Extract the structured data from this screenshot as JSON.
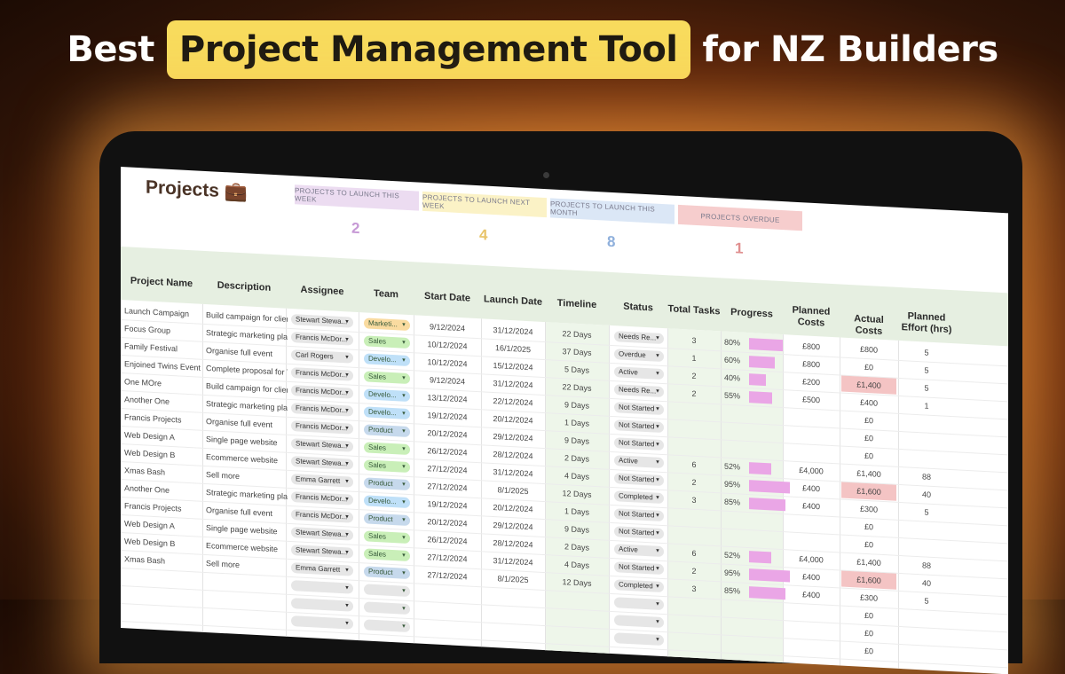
{
  "headline": {
    "before": "Best",
    "highlight": "Project Management Tool",
    "after": "for NZ Builders"
  },
  "sheet": {
    "title": "Projects 💼",
    "kpis": [
      {
        "label": "PROJECTS TO LAUNCH THIS WEEK",
        "value": "2",
        "tab_color": "#ecdcf1",
        "num_color": "#c79ad6"
      },
      {
        "label": "PROJECTS TO LAUNCH NEXT WEEK",
        "value": "4",
        "tab_color": "#fbf2c6",
        "num_color": "#e8c46a"
      },
      {
        "label": "PROJECTS TO LAUNCH THIS MONTH",
        "value": "8",
        "tab_color": "#dbe7f6",
        "num_color": "#8fb0dc"
      },
      {
        "label": "PROJECTS OVERDUE",
        "value": "1",
        "tab_color": "#f6cdcd",
        "num_color": "#e08f8f"
      }
    ],
    "columns": [
      "Project Name",
      "Description",
      "Assignee",
      "Team",
      "Start Date",
      "Launch Date",
      "Timeline",
      "Status",
      "Total Tasks",
      "Progress",
      "Planned Costs",
      "Actual Costs",
      "Planned Effort (hrs)"
    ],
    "team_colors": {
      "Marketi...": "#f9dba0",
      "Sales": "#c9efb8",
      "Develo...": "#bfe0f8",
      "Product": "#c6d9ec"
    },
    "rows": [
      {
        "name": "Launch Campaign",
        "desc": "Build campaign for client",
        "assignee": "Stewart Stewa...",
        "team": "Marketi...",
        "start": "9/12/2024",
        "launch": "31/12/2024",
        "timeline": "22 Days",
        "status": "Needs Re...",
        "tasks": "3",
        "progress": 0.8,
        "progress_label": "80%",
        "planned": "£800",
        "actual": "£800",
        "actual_over": false,
        "effort": "5"
      },
      {
        "name": "Focus Group",
        "desc": "Strategic marketing plan",
        "assignee": "Francis McDor...",
        "team": "Sales",
        "start": "10/12/2024",
        "launch": "16/1/2025",
        "timeline": "37 Days",
        "status": "Overdue",
        "tasks": "1",
        "progress": 0.6,
        "progress_label": "60%",
        "planned": "£800",
        "actual": "£0",
        "actual_over": false,
        "effort": "5"
      },
      {
        "name": "Family Festival",
        "desc": "Organise full event",
        "assignee": "Carl Rogers",
        "team": "Develo...",
        "start": "10/12/2024",
        "launch": "15/12/2024",
        "timeline": "5 Days",
        "status": "Active",
        "tasks": "2",
        "progress": 0.4,
        "progress_label": "40%",
        "planned": "£200",
        "actual": "£1,400",
        "actual_over": true,
        "effort": "5"
      },
      {
        "name": "Enjoined Twins Event",
        "desc": "Complete proposal for Tw",
        "assignee": "Francis McDor...",
        "team": "Sales",
        "start": "9/12/2024",
        "launch": "31/12/2024",
        "timeline": "22 Days",
        "status": "Needs Re...",
        "tasks": "2",
        "progress": 0.55,
        "progress_label": "55%",
        "planned": "£500",
        "actual": "£400",
        "actual_over": false,
        "effort": "1"
      },
      {
        "name": "One MOre",
        "desc": "Build campaign for client",
        "assignee": "Francis McDor...",
        "team": "Develo...",
        "start": "13/12/2024",
        "launch": "22/12/2024",
        "timeline": "9 Days",
        "status": "Not Started",
        "tasks": "",
        "progress": null,
        "progress_label": "",
        "planned": "",
        "actual": "£0",
        "actual_over": false,
        "effort": ""
      },
      {
        "name": "Another One",
        "desc": "Strategic marketing plan",
        "assignee": "Francis McDor...",
        "team": "Develo...",
        "start": "19/12/2024",
        "launch": "20/12/2024",
        "timeline": "1 Days",
        "status": "Not Started",
        "tasks": "",
        "progress": null,
        "progress_label": "",
        "planned": "",
        "actual": "£0",
        "actual_over": false,
        "effort": ""
      },
      {
        "name": "Francis Projects",
        "desc": "Organise full event",
        "assignee": "Francis McDor...",
        "team": "Product",
        "start": "20/12/2024",
        "launch": "29/12/2024",
        "timeline": "9 Days",
        "status": "Not Started",
        "tasks": "",
        "progress": null,
        "progress_label": "",
        "planned": "",
        "actual": "£0",
        "actual_over": false,
        "effort": ""
      },
      {
        "name": "Web Design A",
        "desc": "Single page website",
        "assignee": "Stewart Stewa...",
        "team": "Sales",
        "start": "26/12/2024",
        "launch": "28/12/2024",
        "timeline": "2 Days",
        "status": "Active",
        "tasks": "6",
        "progress": 0.52,
        "progress_label": "52%",
        "planned": "£4,000",
        "actual": "£1,400",
        "actual_over": false,
        "effort": "88"
      },
      {
        "name": "Web Design B",
        "desc": "Ecommerce website",
        "assignee": "Stewart Stewa...",
        "team": "Sales",
        "start": "27/12/2024",
        "launch": "31/12/2024",
        "timeline": "4 Days",
        "status": "Not Started",
        "tasks": "2",
        "progress": 0.95,
        "progress_label": "95%",
        "planned": "£400",
        "actual": "£1,600",
        "actual_over": true,
        "effort": "40"
      },
      {
        "name": "Xmas Bash",
        "desc": "Sell more",
        "assignee": "Emma Garrett",
        "team": "Product",
        "start": "27/12/2024",
        "launch": "8/1/2025",
        "timeline": "12 Days",
        "status": "Completed",
        "tasks": "3",
        "progress": 0.85,
        "progress_label": "85%",
        "planned": "£400",
        "actual": "£300",
        "actual_over": false,
        "effort": "5"
      },
      {
        "name": "Another One",
        "desc": "Strategic marketing plan",
        "assignee": "Francis McDor...",
        "team": "Develo...",
        "start": "19/12/2024",
        "launch": "20/12/2024",
        "timeline": "1 Days",
        "status": "Not Started",
        "tasks": "",
        "progress": null,
        "progress_label": "",
        "planned": "",
        "actual": "£0",
        "actual_over": false,
        "effort": ""
      },
      {
        "name": "Francis Projects",
        "desc": "Organise full event",
        "assignee": "Francis McDor...",
        "team": "Product",
        "start": "20/12/2024",
        "launch": "29/12/2024",
        "timeline": "9 Days",
        "status": "Not Started",
        "tasks": "",
        "progress": null,
        "progress_label": "",
        "planned": "",
        "actual": "£0",
        "actual_over": false,
        "effort": ""
      },
      {
        "name": "Web Design A",
        "desc": "Single page website",
        "assignee": "Stewart Stewa...",
        "team": "Sales",
        "start": "26/12/2024",
        "launch": "28/12/2024",
        "timeline": "2 Days",
        "status": "Active",
        "tasks": "6",
        "progress": 0.52,
        "progress_label": "52%",
        "planned": "£4,000",
        "actual": "£1,400",
        "actual_over": false,
        "effort": "88"
      },
      {
        "name": "Web Design B",
        "desc": "Ecommerce website",
        "assignee": "Stewart Stewa...",
        "team": "Sales",
        "start": "27/12/2024",
        "launch": "31/12/2024",
        "timeline": "4 Days",
        "status": "Not Started",
        "tasks": "2",
        "progress": 0.95,
        "progress_label": "95%",
        "planned": "£400",
        "actual": "£1,600",
        "actual_over": true,
        "effort": "40"
      },
      {
        "name": "Xmas Bash",
        "desc": "Sell more",
        "assignee": "Emma Garrett",
        "team": "Product",
        "start": "27/12/2024",
        "launch": "8/1/2025",
        "timeline": "12 Days",
        "status": "Completed",
        "tasks": "3",
        "progress": 0.85,
        "progress_label": "85%",
        "planned": "£400",
        "actual": "£300",
        "actual_over": false,
        "effort": "5"
      },
      {
        "name": "",
        "desc": "",
        "assignee": "",
        "team": "",
        "start": "",
        "launch": "",
        "timeline": "",
        "status": "",
        "tasks": "",
        "progress": null,
        "progress_label": "",
        "planned": "",
        "actual": "£0",
        "actual_over": false,
        "effort": ""
      },
      {
        "name": "",
        "desc": "",
        "assignee": "",
        "team": "",
        "start": "",
        "launch": "",
        "timeline": "",
        "status": "",
        "tasks": "",
        "progress": null,
        "progress_label": "",
        "planned": "",
        "actual": "£0",
        "actual_over": false,
        "effort": ""
      },
      {
        "name": "",
        "desc": "",
        "assignee": "",
        "team": "",
        "start": "",
        "launch": "",
        "timeline": "",
        "status": "",
        "tasks": "",
        "progress": null,
        "progress_label": "",
        "planned": "",
        "actual": "£0",
        "actual_over": false,
        "effort": ""
      }
    ]
  }
}
